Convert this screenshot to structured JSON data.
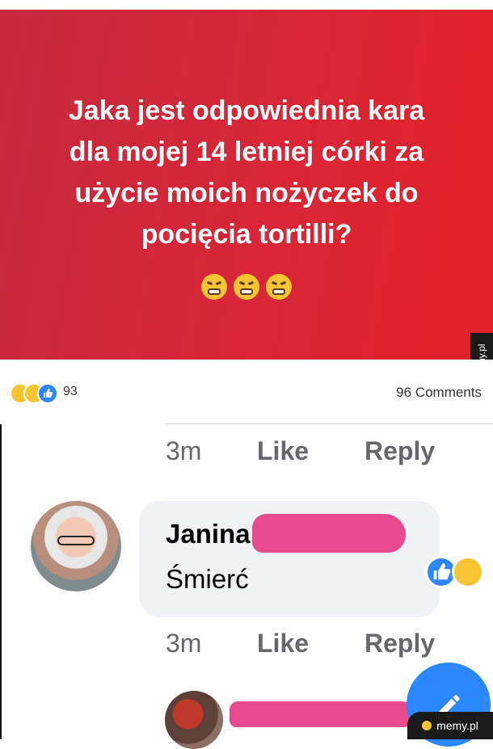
{
  "post": {
    "lines": [
      "Jaka jest odpowiednia kara",
      "dla mojej 14 letniej córki za",
      "użycie moich nożyczek do",
      "pocięcia tortilli?"
    ],
    "background_colors": [
      "#c62a3e",
      "#e32128"
    ],
    "emoji_icons": [
      "tired-face-icon",
      "tired-face-icon",
      "tired-face-icon"
    ]
  },
  "reactions": {
    "icons": [
      "haha-icon",
      "wow-icon",
      "like-icon"
    ],
    "count": "93",
    "comments": "96 Comments"
  },
  "comment_actions": {
    "time": "3m",
    "like": "Like",
    "reply": "Reply"
  },
  "comment": {
    "author": "Janina",
    "text": "Śmierć",
    "reactions": [
      "like-icon",
      "haha-icon"
    ]
  },
  "watermark": {
    "side": "memy.pl",
    "corner": "memy.pl"
  },
  "colors": {
    "accent_blue": "#2d88ff",
    "redaction_pink": "#e84a8f"
  }
}
